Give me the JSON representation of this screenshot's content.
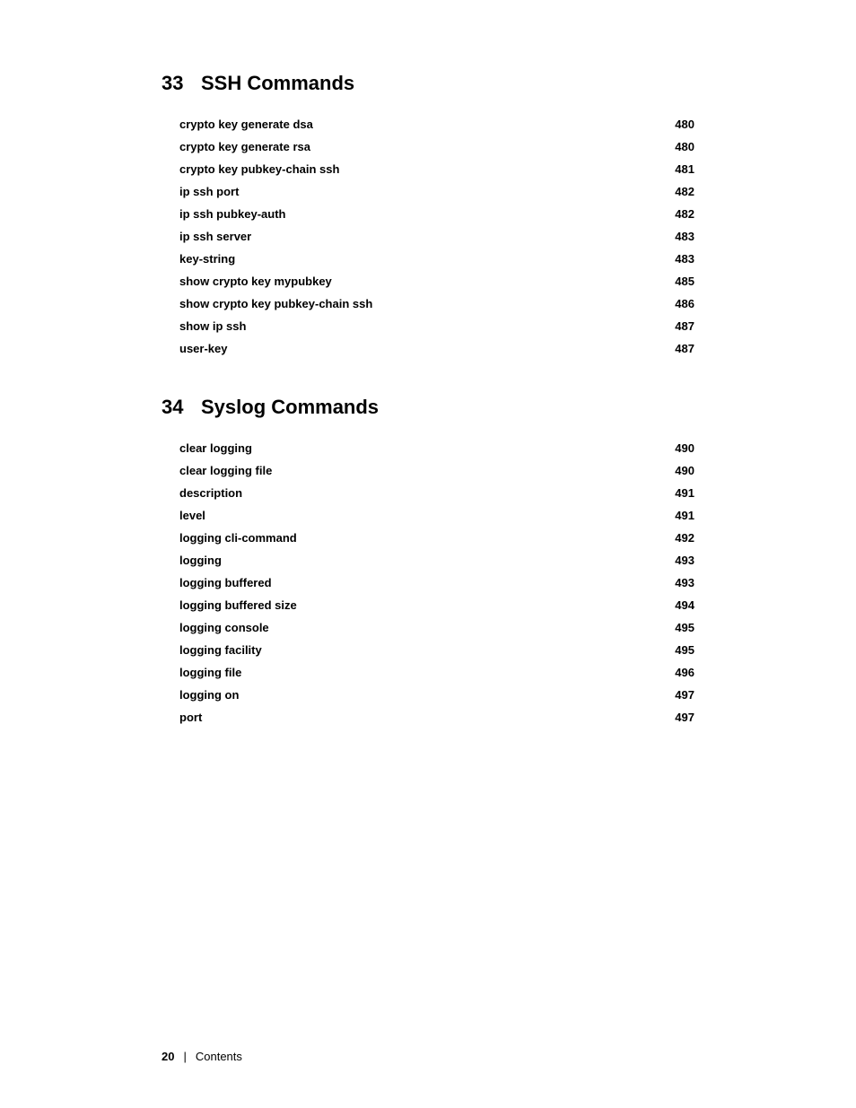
{
  "sections": [
    {
      "number": "33",
      "title": "SSH Commands",
      "entries": [
        {
          "label": "crypto key generate dsa",
          "page": "480"
        },
        {
          "label": "crypto key generate rsa",
          "page": "480"
        },
        {
          "label": "crypto key pubkey-chain ssh",
          "page": "481"
        },
        {
          "label": "ip ssh port",
          "page": "482"
        },
        {
          "label": "ip ssh pubkey-auth",
          "page": "482"
        },
        {
          "label": "ip ssh server",
          "page": "483"
        },
        {
          "label": "key-string",
          "page": "483"
        },
        {
          "label": "show crypto key mypubkey",
          "page": "485"
        },
        {
          "label": "show crypto key pubkey-chain ssh",
          "page": "486"
        },
        {
          "label": "show ip ssh",
          "page": "487"
        },
        {
          "label": "user-key",
          "page": "487"
        }
      ]
    },
    {
      "number": "34",
      "title": "Syslog Commands",
      "entries": [
        {
          "label": "clear logging",
          "page": "490"
        },
        {
          "label": "clear logging file",
          "page": "490"
        },
        {
          "label": "description",
          "page": "491"
        },
        {
          "label": "level",
          "page": "491"
        },
        {
          "label": "logging cli-command",
          "page": "492"
        },
        {
          "label": "logging",
          "page": "493"
        },
        {
          "label": "logging buffered",
          "page": "493"
        },
        {
          "label": "logging buffered size",
          "page": "494"
        },
        {
          "label": "logging console",
          "page": "495"
        },
        {
          "label": "logging facility",
          "page": "495"
        },
        {
          "label": "logging file",
          "page": "496"
        },
        {
          "label": "logging on",
          "page": "497"
        },
        {
          "label": "port",
          "page": "497"
        }
      ]
    }
  ],
  "footer": {
    "page_number": "20",
    "separator": "|",
    "label": "Contents"
  }
}
